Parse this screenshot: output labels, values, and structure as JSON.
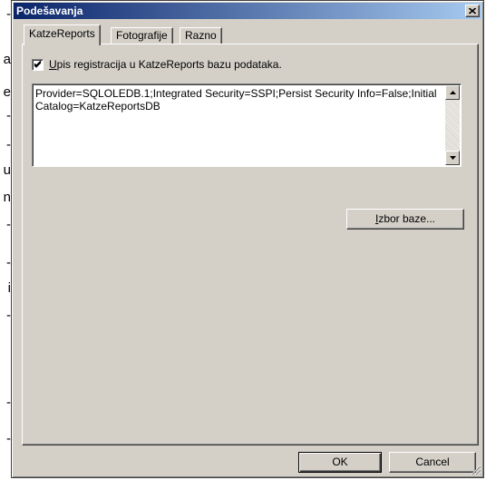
{
  "background_fragment": {
    "chars": [
      "-",
      "a",
      "e",
      "-",
      "-",
      "u",
      "n",
      "-",
      "-",
      "i",
      "-",
      "-",
      "-"
    ]
  },
  "dialog": {
    "title": "Podešavanja",
    "tabs": [
      {
        "label": "KatzeReports",
        "active": true
      },
      {
        "label": "Fotografije",
        "active": false
      },
      {
        "label": "Razno",
        "active": false
      }
    ],
    "checkbox": {
      "label_first": "U",
      "label_rest": "pis registracija u KatzeReports bazu podataka.",
      "checked": true
    },
    "connection_string": "Provider=SQLOLEDB.1;Integrated Security=SSPI;Persist Security Info=False;Initial Catalog=KatzeReportsDB",
    "select_db_button": {
      "first": "I",
      "rest": "zbor baze..."
    },
    "ok_label": "OK",
    "cancel_label": "Cancel"
  },
  "colors": {
    "titlebar_start": "#0a246a",
    "titlebar_end": "#a6caf0",
    "face": "#d4d0c8"
  }
}
